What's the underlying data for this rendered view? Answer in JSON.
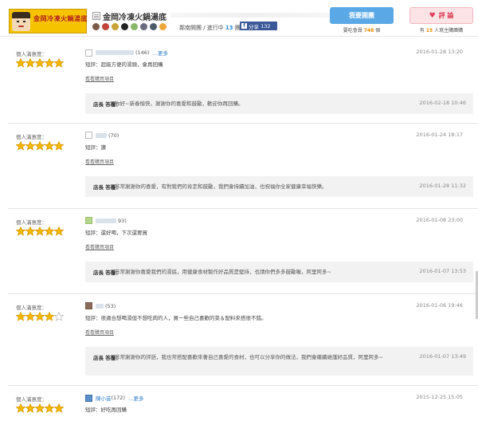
{
  "store": {
    "logo_text": "金岡冷凍火鍋湯底",
    "logo_vertical": "金岡",
    "title": "金岡冷凍火鍋湯底",
    "meta_prefix": "鄰南開團 / 進行中",
    "active_count": "13",
    "active_unit": "團",
    "share_label": "分享",
    "share_count": "132"
  },
  "actions": {
    "want_label": "我要開團",
    "want_meta_prefix": "要吃會員",
    "want_count": "748",
    "want_meta_suffix": "個",
    "rate_label": "評 論",
    "rate_meta_prefix": "有",
    "rate_count": "15",
    "rate_meta_suffix": "人寫主購團購"
  },
  "review_common": {
    "rating_label": "個人滿意度：",
    "view_link": "看看購買項目",
    "reply_label": "店長 答覆："
  },
  "reviews": [
    {
      "user_suffix": "(146)",
      "more": "…更多",
      "date": "2016-01-28 13:20",
      "comment": "短評：超級方便的湯頭，會再回購",
      "stars": 5,
      "reply_text": "你好~新春愉快，謝謝你的喜愛和鼓勵，歡迎你再回購。",
      "reply_date": "2016-02-18 10:46"
    },
    {
      "user_suffix": "(70)",
      "more": "",
      "date": "2016-01-24 18:17",
      "comment": "短評：讚",
      "stars": 5,
      "reply_text": "非常謝謝你的喜愛，有對我們的肯定和鼓勵，我們會持續加油，也祝福你全家健康幸福快樂。",
      "reply_date": "2016-01-28 11:32"
    },
    {
      "user_suffix": "93)",
      "more": "",
      "date": "2016-01-08 23:00",
      "comment": "短評：還好喝，下次還要買",
      "stars": 5,
      "reply_text": "非常謝謝你喜愛我們的湯底，用健康食材製作好品質是堅持，也請你們多多鼓勵喔，阿里阿多~",
      "reply_date": "2016-01-07 13:53"
    },
    {
      "user_suffix": "(53)",
      "more": "",
      "date": "2016-01-06 19:46",
      "comment": "短評：很適合想喝湯但不想吃肉的人，買一些自己喜歡的菜＆配料來搭很不錯。",
      "stars": 4,
      "reply_text": "非常謝謝你的評語，我也常搭配喜歡來著自己喜愛的食材，也可以分享你的做法，我們會繼續維護好品質，阿里阿多~",
      "reply_date": "2016-01-07 13:49"
    },
    {
      "user_name": "陳小芸",
      "user_suffix": "(172)",
      "more": "…更多",
      "date": "2015-12-25 15:05",
      "comment": "短評：好吃再回購",
      "stars": 5
    }
  ],
  "colors": {
    "star": "#f5b800",
    "link": "#2a7cc7",
    "accent_blue": "#5aa9e6",
    "accent_pink": "#fbe3e6"
  }
}
